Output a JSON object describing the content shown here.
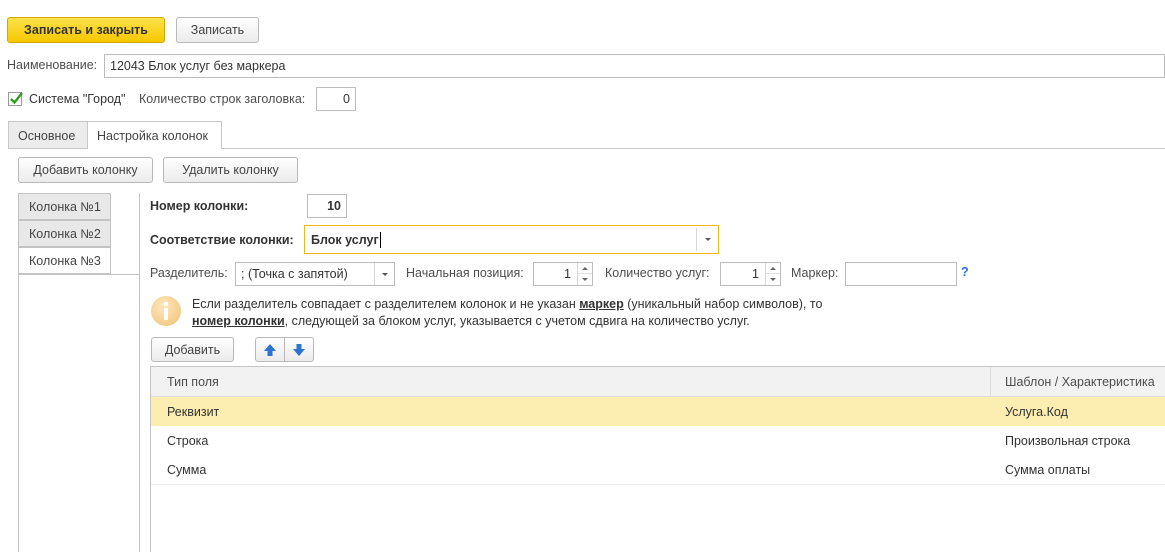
{
  "toolbar": {
    "save_close_label": "Записать и закрыть",
    "save_label": "Записать"
  },
  "name_field": {
    "label": "Наименование:",
    "value": "12043 Блок услуг без маркера"
  },
  "system_checkbox": {
    "label": "Система \"Город\"",
    "checked": true
  },
  "header_rows": {
    "label": "Количество строк заголовка:",
    "value": "0"
  },
  "tabs": [
    {
      "label": "Основное",
      "active": false
    },
    {
      "label": "Настройка колонок",
      "active": true
    }
  ],
  "column_buttons": {
    "add_label": "Добавить колонку",
    "remove_label": "Удалить колонку"
  },
  "column_list": [
    {
      "label": "Колонка №1",
      "active": false
    },
    {
      "label": "Колонка №2",
      "active": false
    },
    {
      "label": "Колонка №3",
      "active": true
    }
  ],
  "column_number": {
    "label": "Номер колонки:",
    "value": "10"
  },
  "column_mapping": {
    "label": "Соответствие колонки:",
    "value": "Блок услуг"
  },
  "separator": {
    "label": "Разделитель:",
    "value": "; (Точка с запятой)"
  },
  "start_position": {
    "label": "Начальная позиция:",
    "value": "1"
  },
  "services_count": {
    "label": "Количество услуг:",
    "value": "1"
  },
  "marker": {
    "label": "Маркер:",
    "value": "",
    "help": "?"
  },
  "info": {
    "icon": "info-icon",
    "part1": "Если разделитель совпадает с разделителем колонок и не указан ",
    "marker_word": "маркер",
    "part2": " (уникальный набор символов), то",
    "column_number_word": "номер колонки",
    "part3": ", следующей за блоком услуг, указывается с учетом сдвига на количество услуг."
  },
  "table_toolbar": {
    "add_label": "Добавить",
    "up_icon": "arrow-up-icon",
    "down_icon": "arrow-down-icon"
  },
  "table": {
    "headers": [
      "Тип поля",
      "Шаблон / Характеристика"
    ],
    "rows": [
      {
        "type": "Реквизит",
        "template": "Услуга.Код",
        "selected": true
      },
      {
        "type": "Строка",
        "template": "Произвольная строка",
        "selected": false
      },
      {
        "type": "Сумма",
        "template": "Сумма оплаты",
        "selected": false
      }
    ]
  },
  "colors": {
    "primary_button": "#f6c700",
    "selected_row": "#fbeeb0",
    "focus_border": "#f2b618",
    "checkbox_check": "#2e9f1d",
    "arrow_blue": "#2c73d2",
    "help_blue": "#2a6fd6"
  }
}
